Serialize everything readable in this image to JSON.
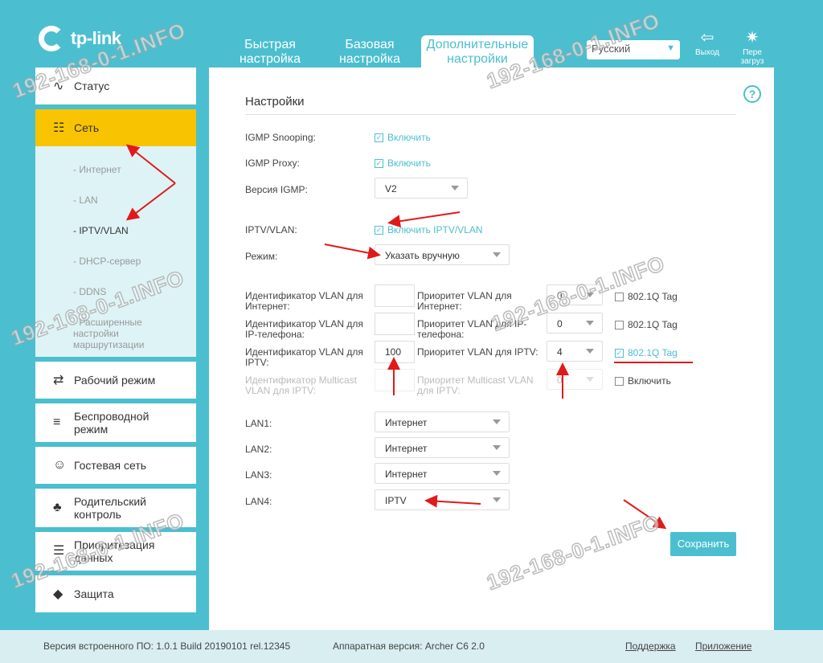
{
  "header": {
    "logo_text": "tp-link",
    "tabs": [
      {
        "label": "Быстрая настройка"
      },
      {
        "label": "Базовая настройка"
      },
      {
        "label": "Дополнительные настройки"
      }
    ],
    "language": "Русский",
    "logout_label": "Выход",
    "reboot_label": "Пере загруз"
  },
  "sidebar": {
    "items": [
      {
        "label": "Статус",
        "icon": "pulse-icon"
      },
      {
        "label": "Сеть",
        "icon": "network-icon"
      },
      {
        "label": "Рабочий режим",
        "icon": "switch-mode-icon"
      },
      {
        "label": "Беспроводной режим",
        "icon": "wifi-icon"
      },
      {
        "label": "Гостевая сеть",
        "icon": "guest-icon"
      },
      {
        "label": "Родительский контроль",
        "icon": "parental-icon"
      },
      {
        "label": "Приоритезация данных",
        "icon": "qos-icon"
      },
      {
        "label": "Защита",
        "icon": "shield-icon"
      }
    ],
    "sub_items": [
      {
        "label": "- Интернет"
      },
      {
        "label": "- LAN"
      },
      {
        "label": "- IPTV/VLAN"
      },
      {
        "label": "- DHCP-сервер"
      },
      {
        "label": "- DDNS"
      },
      {
        "label": "- Расширенные настройки маршрутизации"
      }
    ]
  },
  "main": {
    "title": "Настройки",
    "help": "?",
    "igmp_snooping": {
      "label": "IGMP Snooping:",
      "check": "Включить"
    },
    "igmp_proxy": {
      "label": "IGMP Proxy:",
      "check": "Включить"
    },
    "igmp_version": {
      "label": "Версия IGMP:",
      "value": "V2"
    },
    "iptv_vlan": {
      "label": "IPTV/VLAN:",
      "check": "Включить IPTV/VLAN"
    },
    "mode": {
      "label": "Режим:",
      "value": "Указать вручную"
    },
    "vlan_rows": [
      {
        "id_label": "Идентификатор VLAN для Интернет:",
        "id_value": "",
        "prio_label": "Приоритет VLAN для Интернет:",
        "prio_value": "0",
        "tag_label": "802.1Q Tag"
      },
      {
        "id_label": "Идентификатор VLAN для IP-телефона:",
        "id_value": "",
        "prio_label": "Приоритет VLAN для IP-телефона:",
        "prio_value": "0",
        "tag_label": "802.1Q Tag"
      },
      {
        "id_label": "Идентификатор VLAN для IPTV:",
        "id_value": "100",
        "prio_label": "Приоритет VLAN для IPTV:",
        "prio_value": "4",
        "tag_label": "802.1Q Tag"
      },
      {
        "id_label": "Идентификатор Multicast VLAN для IPTV:",
        "id_value": "",
        "prio_label": "Приоритет Multicast VLAN для IPTV:",
        "prio_value": "0",
        "tag_label": "Включить"
      }
    ],
    "lan_ports": [
      {
        "label": "LAN1:",
        "value": "Интернет"
      },
      {
        "label": "LAN2:",
        "value": "Интернет"
      },
      {
        "label": "LAN3:",
        "value": "Интернет"
      },
      {
        "label": "LAN4:",
        "value": "IPTV"
      }
    ],
    "save_label": "Сохранить"
  },
  "footer": {
    "firmware": "Версия встроенного ПО: 1.0.1 Build 20190101 rel.12345",
    "hardware": "Аппаратная версия: Archer C6 2.0",
    "support": "Поддержка",
    "app": "Приложение"
  },
  "watermark": "192-168-0-1.INFO"
}
